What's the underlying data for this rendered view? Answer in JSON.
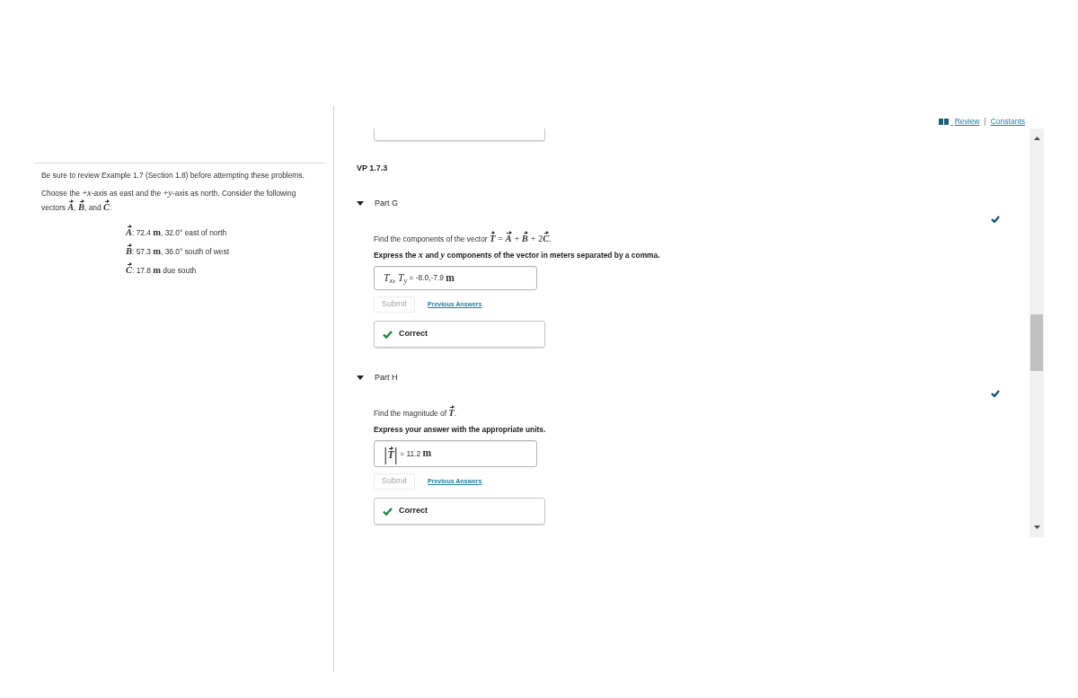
{
  "header": {
    "links": [
      {
        "kind": "review",
        "label": "Review"
      },
      {
        "kind": "plain",
        "label": "Constants"
      }
    ],
    "separator": "|"
  },
  "problem": {
    "note": [
      {
        "kind": "text",
        "text": "Be sure to review Example 1.7 (Section 1.8) before attempting these problems."
      }
    ],
    "setup": [
      {
        "kind": "text",
        "text": "Choose the "
      },
      {
        "kind": "op",
        "text": "+"
      },
      {
        "kind": "var",
        "text": "x"
      },
      {
        "kind": "text",
        "text": "-axis as east and the "
      },
      {
        "kind": "op",
        "text": "+"
      },
      {
        "kind": "var",
        "text": "y"
      },
      {
        "kind": "text",
        "text": "-axis as north. Consider the following vectors "
      },
      {
        "kind": "vector",
        "text": "A"
      },
      {
        "kind": "text",
        "text": ", "
      },
      {
        "kind": "vector",
        "text": "B"
      },
      {
        "kind": "text",
        "text": ", and "
      },
      {
        "kind": "vector",
        "text": "C"
      },
      {
        "kind": "text",
        "text": ":"
      }
    ],
    "vectors": [
      [
        {
          "kind": "vector",
          "text": "A"
        },
        {
          "kind": "text",
          "text": ": 72.4 "
        },
        {
          "kind": "unit",
          "text": "m"
        },
        {
          "kind": "text",
          "text": ", 32.0° east of north"
        }
      ],
      [
        {
          "kind": "vector",
          "text": "B"
        },
        {
          "kind": "text",
          "text": ": 57.3 "
        },
        {
          "kind": "unit",
          "text": "m"
        },
        {
          "kind": "text",
          "text": ", 36.0° south of west"
        }
      ],
      [
        {
          "kind": "vector",
          "text": "C"
        },
        {
          "kind": "text",
          "text": ": 17.8 "
        },
        {
          "kind": "unit",
          "text": "m"
        },
        {
          "kind": "text",
          "text": " due south"
        }
      ]
    ]
  },
  "heading": "VP 1.7.3",
  "parts": [
    {
      "title": "Part G",
      "expanded": true,
      "completed": true,
      "prompt": [
        {
          "kind": "text",
          "text": "Find the components of the vector "
        },
        {
          "kind": "vector",
          "text": "T"
        },
        {
          "kind": "op",
          "text": " = "
        },
        {
          "kind": "vector",
          "text": "A"
        },
        {
          "kind": "op",
          "text": " + "
        },
        {
          "kind": "vector",
          "text": "B"
        },
        {
          "kind": "op",
          "text": " + 2"
        },
        {
          "kind": "vector",
          "text": "C"
        },
        {
          "kind": "text",
          "text": "."
        }
      ],
      "instruction": [
        {
          "kind": "text",
          "text": "Express the "
        },
        {
          "kind": "var",
          "text": "x"
        },
        {
          "kind": "text",
          "text": " and "
        },
        {
          "kind": "var",
          "text": "y"
        },
        {
          "kind": "text",
          "text": " components of the vector in meters separated by a comma."
        }
      ],
      "answer": [
        {
          "kind": "var",
          "text": "T$_{x}$"
        },
        {
          "kind": "op",
          "text": ", "
        },
        {
          "kind": "var",
          "text": "T$_{y}$"
        },
        {
          "kind": "text",
          "text": " = -8.0,-7.9 "
        },
        {
          "kind": "unit",
          "text": "m"
        }
      ],
      "submit": {
        "label": "Submit",
        "disabled": true
      },
      "previous_answers": "Previous Answers",
      "feedback": {
        "kind": "correct",
        "text": "Correct"
      }
    },
    {
      "title": "Part H",
      "expanded": true,
      "completed": true,
      "prompt": [
        {
          "kind": "text",
          "text": "Find the magnitude of "
        },
        {
          "kind": "vector",
          "text": "T"
        },
        {
          "kind": "text",
          "text": "."
        }
      ],
      "instruction": [
        {
          "kind": "text",
          "text": "Express your answer with the appropriate units."
        }
      ],
      "answer": [
        {
          "kind": "delim",
          "text": "|"
        },
        {
          "kind": "vector",
          "text": "T"
        },
        {
          "kind": "delim",
          "text": "|"
        },
        {
          "kind": "text",
          "text": " = 11.2 "
        },
        {
          "kind": "unit",
          "text": "m"
        }
      ],
      "submit": {
        "label": "Submit",
        "disabled": true
      },
      "previous_answers": "Previous Answers",
      "feedback": {
        "kind": "correct",
        "text": "Correct"
      }
    }
  ]
}
